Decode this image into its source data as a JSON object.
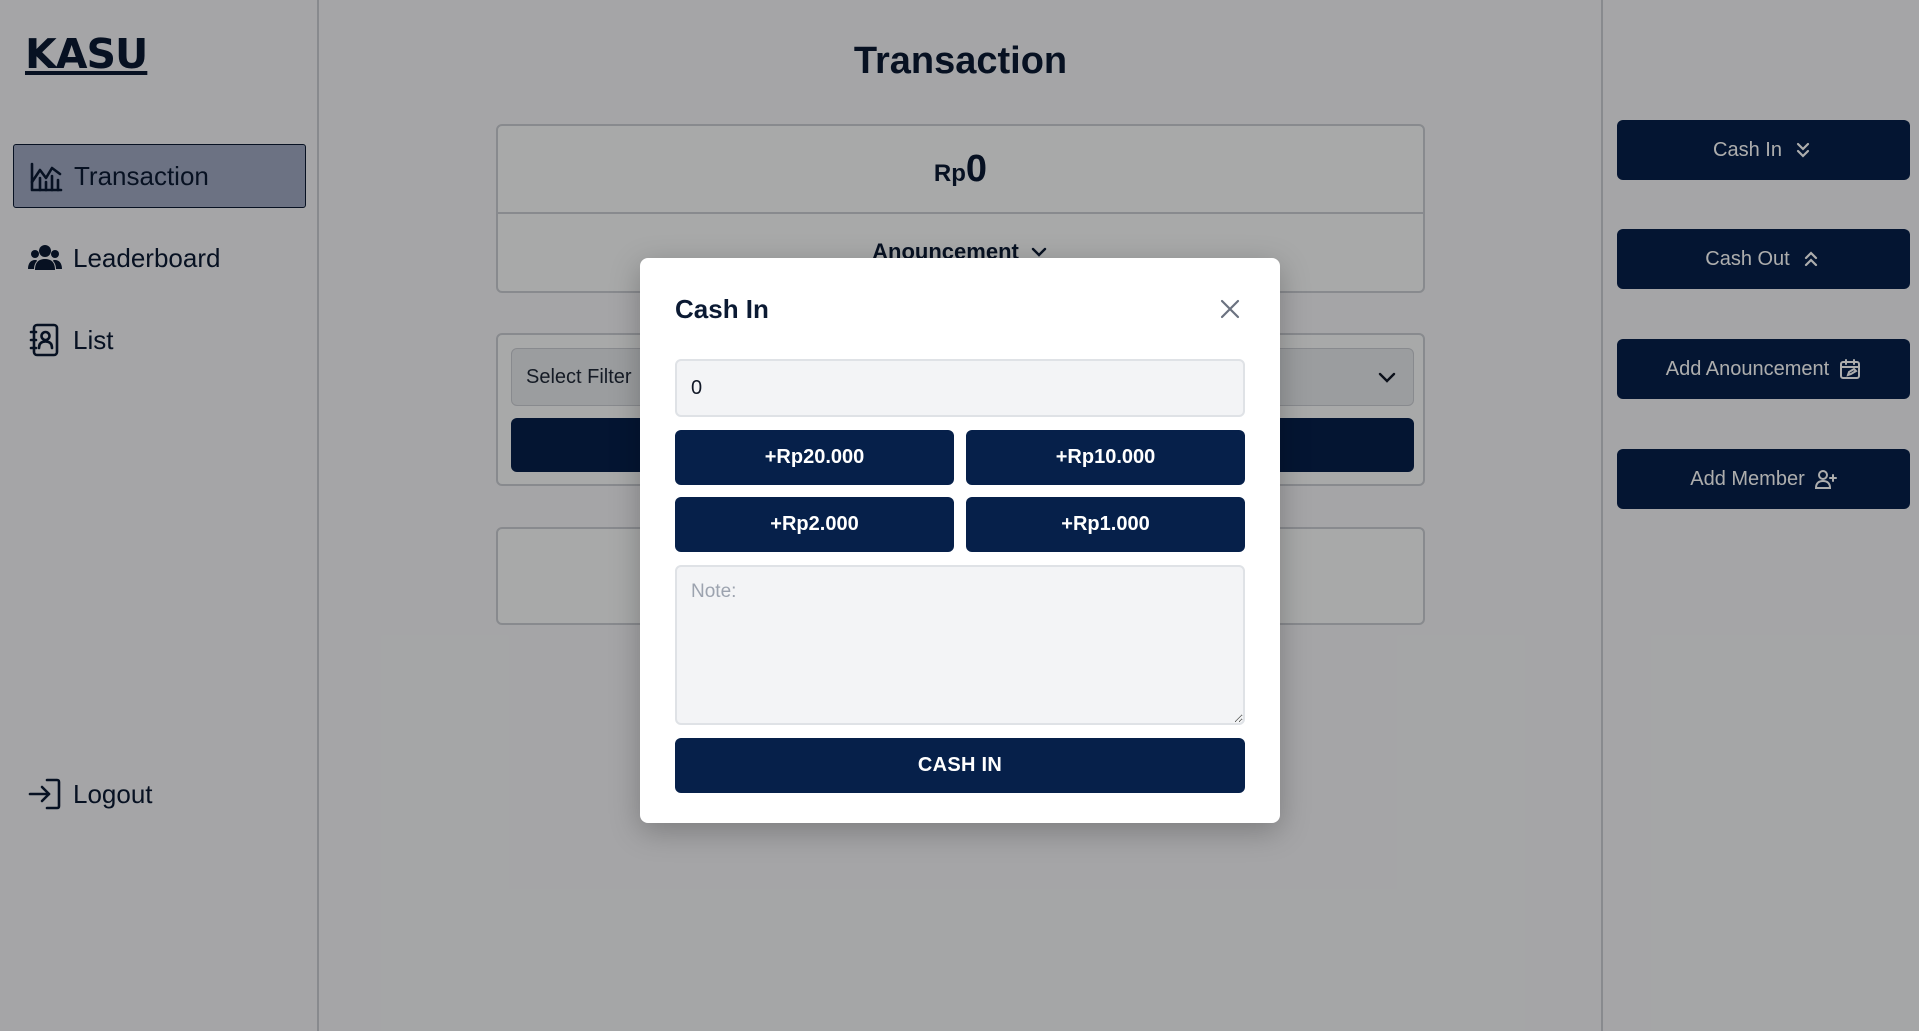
{
  "sidebar": {
    "logo": "KASU",
    "items": [
      {
        "label": "Transaction",
        "icon": "chart-icon",
        "active": true
      },
      {
        "label": "Leaderboard",
        "icon": "users-icon",
        "active": false
      },
      {
        "label": "List",
        "icon": "contacts-book-icon",
        "active": false
      }
    ],
    "logout_label": "Logout"
  },
  "main": {
    "title": "Transaction",
    "balance": {
      "currency": "Rp",
      "amount": "0"
    },
    "announcement_label": "Anouncement",
    "filter": {
      "placeholder": "Select Filter"
    }
  },
  "actions": {
    "cash_in": "Cash In",
    "cash_out": "Cash Out",
    "add_announcement": "Add Anouncement",
    "add_member": "Add Member"
  },
  "modal": {
    "title": "Cash In",
    "amount_value": "0",
    "quick_amounts": [
      "+Rp20.000",
      "+Rp10.000",
      "+Rp2.000",
      "+Rp1.000"
    ],
    "note_placeholder": "Note:",
    "submit_label": "CASH IN"
  },
  "colors": {
    "primary": "#06204a",
    "active_nav": "#9fa9c1",
    "background": "#f3f4f6"
  }
}
